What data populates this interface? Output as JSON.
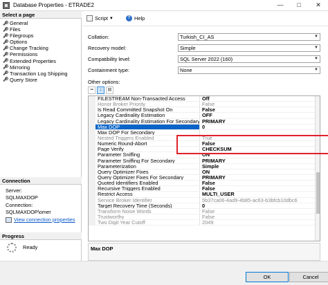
{
  "window": {
    "title": "Database Properties - ETRADE2",
    "minimize": "—",
    "maximize": "□",
    "close": "✕"
  },
  "sidebar": {
    "select_page_header": "Select a page",
    "pages": [
      {
        "label": "General",
        "icon": "wrench-icon"
      },
      {
        "label": "Files",
        "icon": "wrench-icon"
      },
      {
        "label": "Filegroups",
        "icon": "wrench-icon"
      },
      {
        "label": "Options",
        "icon": "wrench-icon"
      },
      {
        "label": "Change Tracking",
        "icon": "wrench-icon"
      },
      {
        "label": "Permissions",
        "icon": "wrench-icon"
      },
      {
        "label": "Extended Properties",
        "icon": "wrench-icon"
      },
      {
        "label": "Mirroring",
        "icon": "wrench-icon"
      },
      {
        "label": "Transaction Log Shipping",
        "icon": "wrench-icon"
      },
      {
        "label": "Query Store",
        "icon": "wrench-icon"
      }
    ],
    "connection_header": "Connection",
    "server_label": "Server:",
    "server_value": "SQLMAXDOP",
    "connection_label": "Connection:",
    "connection_value": "SQLMAXDOP\\omer",
    "view_connection_properties": "View connection properties",
    "progress_header": "Progress",
    "progress_status": "Ready"
  },
  "toolbar": {
    "script_label": "Script",
    "help_label": "Help"
  },
  "form": {
    "collation_label": "Collation:",
    "collation_value": "Turkish_CI_AS",
    "recovery_model_label": "Recovery model:",
    "recovery_model_value": "Simple",
    "compatibility_level_label": "Compatibility level:",
    "compatibility_level_value": "SQL Server 2022 (160)",
    "containment_type_label": "Containment type:",
    "containment_type_value": "None",
    "other_options_label": "Other options:"
  },
  "options_grid": {
    "rows": [
      {
        "name": "FILESTREAM Non-Transacted Access",
        "value": "Off",
        "state": "bold"
      },
      {
        "name": "Honor Broker Priority",
        "value": "False",
        "state": "disabled"
      },
      {
        "name": "Is Read Committed Snapshot On",
        "value": "False",
        "state": "bold"
      },
      {
        "name": "Legacy Cardinality Estimation",
        "value": "OFF",
        "state": "bold"
      },
      {
        "name": "Legacy Cardinality Estimation For Secondary",
        "value": "PRIMARY",
        "state": "bold"
      },
      {
        "name": "Max DOP",
        "value": "0",
        "state": "selected"
      },
      {
        "name": "Max DOP For Secondary",
        "value": "",
        "state": "normal"
      },
      {
        "name": "Nested Triggers Enabled",
        "value": "True",
        "state": "disabled"
      },
      {
        "name": "Numeric Round-Abort",
        "value": "False",
        "state": "bold"
      },
      {
        "name": "Page Verify",
        "value": "CHECKSUM",
        "state": "bold"
      },
      {
        "name": "Parameter Sniffing",
        "value": "ON",
        "state": "bold"
      },
      {
        "name": "Parameter Sniffing For Secondary",
        "value": "PRIMARY",
        "state": "bold"
      },
      {
        "name": "Parameterization",
        "value": "Simple",
        "state": "bold"
      },
      {
        "name": "Query Optimizer Fixes",
        "value": "ON",
        "state": "bold"
      },
      {
        "name": "Query Optimizer Fixes For Secondary",
        "value": "PRIMARY",
        "state": "bold"
      },
      {
        "name": "Quoted Identifiers Enabled",
        "value": "False",
        "state": "bold"
      },
      {
        "name": "Recursive Triggers Enabled",
        "value": "False",
        "state": "bold"
      },
      {
        "name": "Restrict Access",
        "value": "MULTI_USER",
        "state": "bold"
      },
      {
        "name": "Service Broker Identifier",
        "value": "5b37ca06-4ad9-4b85-ac63-b3bfcb10dbc6",
        "state": "disabled"
      },
      {
        "name": "Target Recovery Time (Seconds)",
        "value": "0",
        "state": "bold"
      },
      {
        "name": "Transform Noise Words",
        "value": "False",
        "state": "disabled"
      },
      {
        "name": "Trustworthy",
        "value": "False",
        "state": "disabled"
      },
      {
        "name": "Two Digit Year Cutoff",
        "value": "2049",
        "state": "disabled"
      }
    ]
  },
  "description": {
    "title": "Max DOP"
  },
  "footer": {
    "ok_label": "OK",
    "cancel_label": "Cancel"
  },
  "colors": {
    "selection": "#0a64c8",
    "highlight_box": "#e0202a",
    "link": "#0a58ca"
  }
}
